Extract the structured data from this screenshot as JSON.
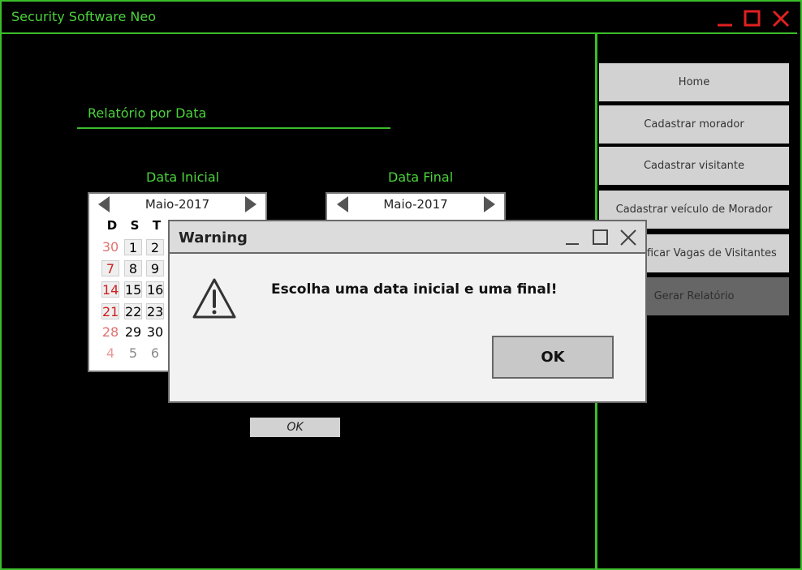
{
  "window": {
    "title": "Security Software Neo"
  },
  "main": {
    "section_title": "Relatório por Data",
    "start_label": "Data Inicial",
    "end_label": "Data Final",
    "ok_label": "OK"
  },
  "calendar_start": {
    "month": "Maio-2017",
    "weekday_headers": [
      "D",
      "S",
      "T"
    ],
    "rows": [
      [
        "30",
        "1",
        "2"
      ],
      [
        "7",
        "8",
        "9"
      ],
      [
        "14",
        "15",
        "16"
      ],
      [
        "21",
        "22",
        "23"
      ],
      [
        "28",
        "29",
        "30"
      ],
      [
        "4",
        "5",
        "6"
      ]
    ]
  },
  "calendar_end": {
    "month": "Maio-2017"
  },
  "sidebar": {
    "items": [
      {
        "label": "Home"
      },
      {
        "label": "Cadastrar morador"
      },
      {
        "label": "Cadastrar visitante"
      },
      {
        "label": "Cadastrar veículo de Morador"
      },
      {
        "label": "Verificar Vagas de Visitantes"
      },
      {
        "label": "Gerar Relatório"
      }
    ]
  },
  "dialog": {
    "title": "Warning",
    "message": "Escolha uma data inicial e uma final!",
    "ok_label": "OK"
  },
  "colors": {
    "accent": "#3bbd2a",
    "close": "#e02020",
    "sunday": "#cc2222"
  },
  "icons": [
    "minimize-icon",
    "maximize-icon",
    "close-icon",
    "warning-icon",
    "chevron-left-icon",
    "chevron-right-icon"
  ]
}
